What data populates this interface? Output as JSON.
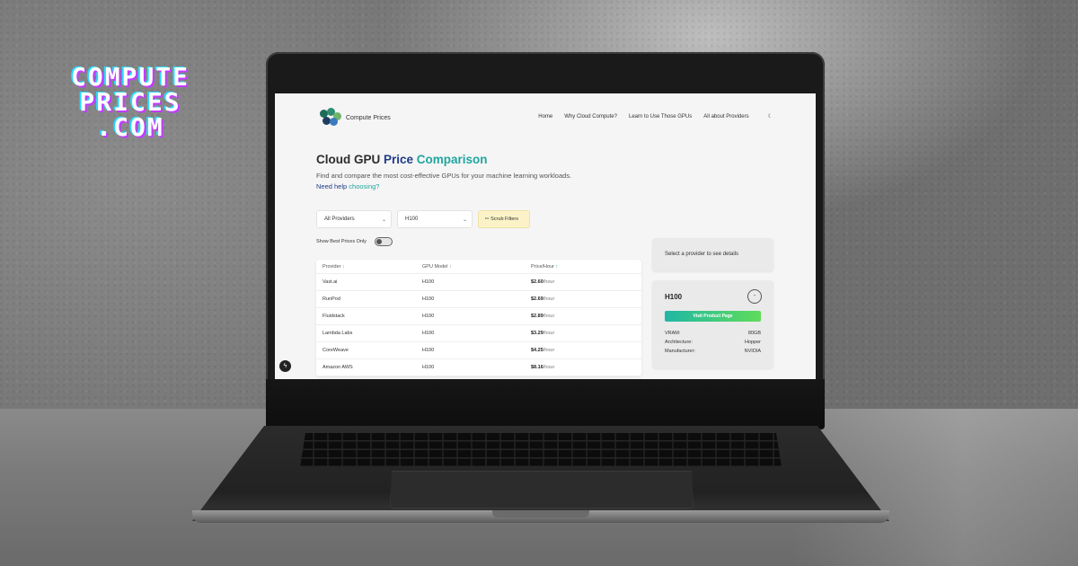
{
  "promo": {
    "logo_lines": [
      "COMPUTE",
      "PRICES",
      ".COM"
    ]
  },
  "site": {
    "brand_name": "Compute Prices",
    "nav": [
      "Home",
      "Why Cloud Compute?",
      "Learn to Use Those GPUs",
      "All about Providers"
    ],
    "theme_icon": "moon-icon"
  },
  "hero": {
    "title_plain": "Cloud GPU ",
    "title_accent1": "Price",
    "title_accent2": " Comparison",
    "subtitle": "Find and compare the most cost-effective GPUs for your machine learning workloads. ",
    "help_text": "Need help",
    "help_link": " choosing?"
  },
  "filters": {
    "provider_select": "All Providers",
    "gpu_select": "H100",
    "scrub_button": "✏ Scrub Filters",
    "toggle_label": "Show Best Prices Only",
    "toggle_on": false
  },
  "table": {
    "headers": [
      "Provider",
      "GPU Model",
      "Price/Hour"
    ],
    "sort_icons": [
      "↕",
      "↕",
      "↑"
    ],
    "rows": [
      {
        "provider": "Vast.ai",
        "gpu": "H100",
        "price": "$2.60",
        "unit": "/hour"
      },
      {
        "provider": "RunPod",
        "gpu": "H100",
        "price": "$2.69",
        "unit": "/hour"
      },
      {
        "provider": "Fluidstack",
        "gpu": "H100",
        "price": "$2.89",
        "unit": "/hour"
      },
      {
        "provider": "Lambda Labs",
        "gpu": "H100",
        "price": "$3.29",
        "unit": "/hour"
      },
      {
        "provider": "CoreWeave",
        "gpu": "H100",
        "price": "$4.25",
        "unit": "/hour"
      },
      {
        "provider": "Amazon AWS",
        "gpu": "H100",
        "price": "$8.16",
        "unit": "/hour"
      }
    ]
  },
  "details": {
    "placeholder": "Select a provider to see details",
    "gpu_name": "H100",
    "collapse_symbol": "-",
    "visit_button": "Visit Product Page",
    "specs": [
      {
        "label": "VRAM:",
        "value": "80GB"
      },
      {
        "label": "Architecture:",
        "value": "Hopper"
      },
      {
        "label": "Manufacturer:",
        "value": "NVIDIA"
      }
    ]
  },
  "colors": {
    "accent_blue": "#1f3a8a",
    "accent_teal": "#1fa6a0",
    "scrub_bg": "#fbf3c7",
    "visit_gradient": [
      "#20b7a4",
      "#5fdc5a"
    ]
  }
}
